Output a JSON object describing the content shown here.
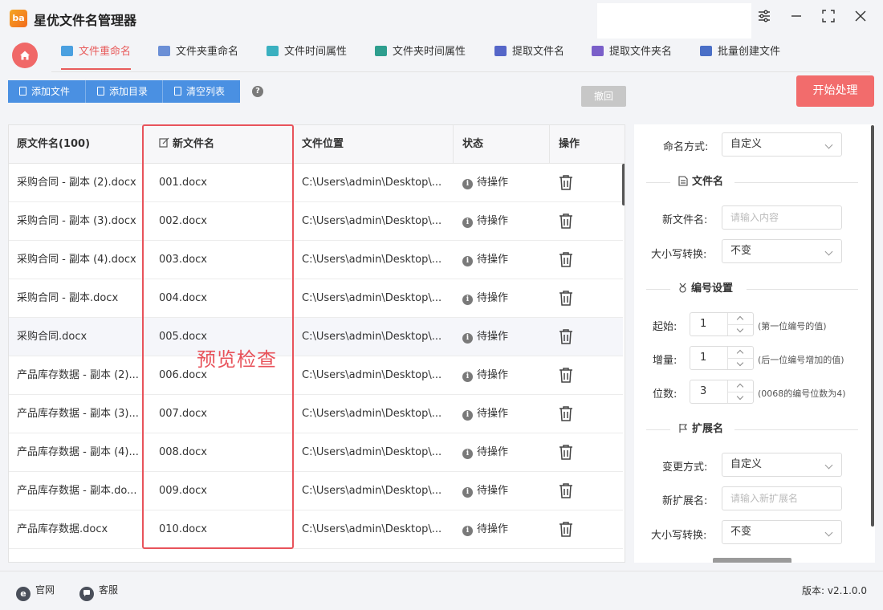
{
  "app": {
    "title": "星优文件名管理器",
    "logo_text": "ba"
  },
  "tabs": [
    {
      "label": "文件重命名",
      "icon": "rename-file-icon",
      "color": "#4aa0e0",
      "active": true
    },
    {
      "label": "文件夹重命名",
      "icon": "rename-folder-icon",
      "color": "#6b8fd6",
      "active": false
    },
    {
      "label": "文件时间属性",
      "icon": "file-time-icon",
      "color": "#3ab0c0",
      "active": false
    },
    {
      "label": "文件夹时间属性",
      "icon": "folder-time-icon",
      "color": "#2e9e8e",
      "active": false
    },
    {
      "label": "提取文件名",
      "icon": "extract-filename-icon",
      "color": "#5566c8",
      "active": false
    },
    {
      "label": "提取文件夹名",
      "icon": "extract-foldername-icon",
      "color": "#7a5fc9",
      "active": false
    },
    {
      "label": "批量创建文件",
      "icon": "batch-create-icon",
      "color": "#4a6fc7",
      "active": false
    }
  ],
  "toolbar": {
    "add_file": "添加文件",
    "add_dir": "添加目录",
    "clear_list": "清空列表",
    "help": "?",
    "undo": "撤回",
    "start": "开始处理"
  },
  "table": {
    "headers": {
      "original": "原文件名(100)",
      "new_name": "新文件名",
      "location": "文件位置",
      "status": "状态",
      "action": "操作"
    },
    "rows": [
      {
        "original": "采购合同 - 副本 (2).docx",
        "new_name": "001.docx",
        "location": "C:\\Users\\admin\\Desktop\\...",
        "status": "待操作"
      },
      {
        "original": "采购合同 - 副本 (3).docx",
        "new_name": "002.docx",
        "location": "C:\\Users\\admin\\Desktop\\...",
        "status": "待操作"
      },
      {
        "original": "采购合同 - 副本 (4).docx",
        "new_name": "003.docx",
        "location": "C:\\Users\\admin\\Desktop\\...",
        "status": "待操作"
      },
      {
        "original": "采购合同 - 副本.docx",
        "new_name": "004.docx",
        "location": "C:\\Users\\admin\\Desktop\\...",
        "status": "待操作"
      },
      {
        "original": "采购合同.docx",
        "new_name": "005.docx",
        "location": "C:\\Users\\admin\\Desktop\\...",
        "status": "待操作"
      },
      {
        "original": "产品库存数据 - 副本 (2)...",
        "new_name": "006.docx",
        "location": "C:\\Users\\admin\\Desktop\\...",
        "status": "待操作"
      },
      {
        "original": "产品库存数据 - 副本 (3)...",
        "new_name": "007.docx",
        "location": "C:\\Users\\admin\\Desktop\\...",
        "status": "待操作"
      },
      {
        "original": "产品库存数据 - 副本 (4)...",
        "new_name": "008.docx",
        "location": "C:\\Users\\admin\\Desktop\\...",
        "status": "待操作"
      },
      {
        "original": "产品库存数据 - 副本.do...",
        "new_name": "009.docx",
        "location": "C:\\Users\\admin\\Desktop\\...",
        "status": "待操作"
      },
      {
        "original": "产品库存数据.docx",
        "new_name": "010.docx",
        "location": "C:\\Users\\admin\\Desktop\\...",
        "status": "待操作"
      }
    ]
  },
  "annotation": {
    "preview_label": "预览检查"
  },
  "settings": {
    "naming_mode_label": "命名方式:",
    "naming_mode_value": "自定义",
    "section_filename": "文件名",
    "new_filename_label": "新文件名:",
    "new_filename_placeholder": "请输入内容",
    "case_label": "大小写转换:",
    "case_value": "不变",
    "section_numbering": "编号设置",
    "start_label": "起始:",
    "start_value": "1",
    "start_hint": "(第一位编号的值)",
    "increment_label": "增量:",
    "increment_value": "1",
    "increment_hint": "(后一位编号增加的值)",
    "digits_label": "位数:",
    "digits_value": "3",
    "digits_hint": "(0068的编号位数为4)",
    "section_extension": "扩展名",
    "ext_mode_label": "变更方式:",
    "ext_mode_value": "自定义",
    "new_ext_label": "新扩展名:",
    "new_ext_placeholder": "请输入新扩展名",
    "ext_case_label": "大小写转换:",
    "ext_case_value": "不变"
  },
  "footer": {
    "website": "官网",
    "website_icon": "e",
    "support": "客服",
    "version_label": "版本:",
    "version": "v2.1.0.0"
  },
  "colors": {
    "accent": "#e85c5c",
    "primary_blue": "#4a90e2",
    "start": "#f26c6c",
    "highlight_box": "#e8535b"
  }
}
